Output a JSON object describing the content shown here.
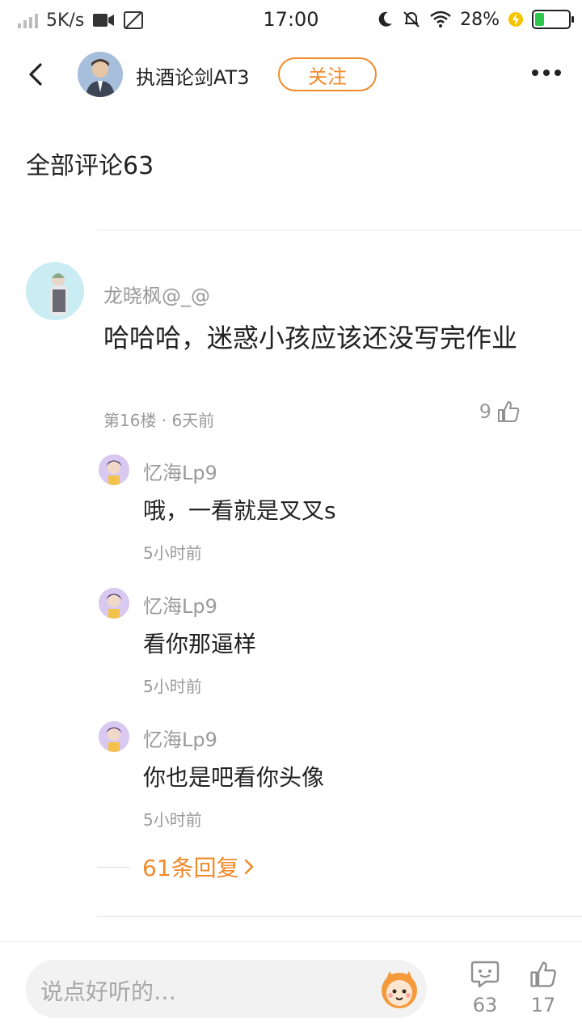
{
  "status_bar": {
    "net_speed": "5K/s",
    "time": "17:00",
    "battery_percent": "28%",
    "battery_level": 0.28,
    "accent_green": "#2dc84d"
  },
  "header": {
    "username": "执酒论剑AT3",
    "follow_label": "关注",
    "accent": "#f08a2a"
  },
  "section_title": "全部评论63",
  "comment": {
    "user": "龙晓枫@_@",
    "text": "哈哈哈，迷惑小孩应该还没写完作业",
    "meta": "第16楼 · 6天前",
    "likes": "9"
  },
  "replies": [
    {
      "user": "忆海Lp9",
      "text": "哦，一看就是叉叉s",
      "time": "5小时前"
    },
    {
      "user": "忆海Lp9",
      "text": "看你那逼样",
      "time": "5小时前"
    },
    {
      "user": "忆海Lp9",
      "text": "你也是吧看你头像",
      "time": "5小时前"
    }
  ],
  "more_replies_label": "61条回复",
  "bottom_bar": {
    "input_placeholder": "说点好听的…",
    "comment_count": "63",
    "like_count": "17"
  },
  "icons": [
    "signal-icon",
    "video-icon",
    "no-sim-icon",
    "moon-icon",
    "mute-icon",
    "wifi-icon",
    "charging-icon",
    "battery-icon",
    "back-icon",
    "more-icon",
    "like-icon",
    "chevron-right-icon",
    "comment-icon",
    "mascot-icon"
  ]
}
